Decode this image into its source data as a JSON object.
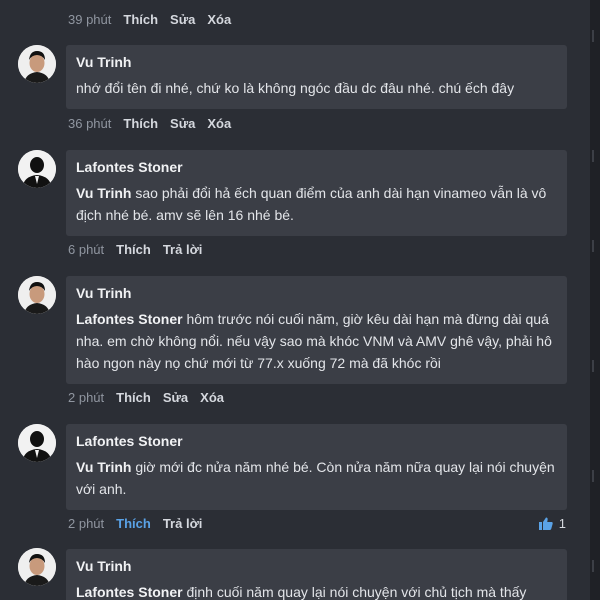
{
  "top_actions": {
    "time": "39 phút",
    "like": "Thích",
    "edit": "Sửa",
    "delete": "Xóa"
  },
  "comments": [
    {
      "author": "Vu Trinh",
      "mention": "",
      "text": "nhớ đổi tên đi nhé, chứ ko là không ngóc đầu dc đâu nhé. chú ếch đây",
      "actions": {
        "time": "36 phút",
        "like": "Thích",
        "a2": "Sửa",
        "a3": "Xóa"
      }
    },
    {
      "author": "Lafontes Stoner",
      "mention": "Vu Trinh",
      "text": " sao phải đổi hả ếch quan điểm của anh dài hạn vinameo vẫn là vô địch nhé bé. amv sẽ lên 16 nhé bé.",
      "actions": {
        "time": "6 phút",
        "like": "Thích",
        "a2": "Trả lời"
      }
    },
    {
      "author": "Vu Trinh",
      "mention": "Lafontes Stoner",
      "text": " hôm trước nói cuối năm, giờ kêu dài hạn mà đừng dài quá nha. em chờ không nổi. nếu vậy sao mà khóc VNM và AMV ghê vậy, phải hô hào ngon này nọ chứ mới từ 77.x xuống 72 mà đã khóc rồi",
      "actions": {
        "time": "2 phút",
        "like": "Thích",
        "a2": "Sửa",
        "a3": "Xóa"
      }
    },
    {
      "author": "Lafontes Stoner",
      "mention": "Vu Trinh",
      "text": " giờ mới đc nửa năm nhé bé. Còn nửa năm nữa quay lại nói chuyện với anh.",
      "actions": {
        "time": "2 phút",
        "like": "Thích",
        "a2": "Trả lời"
      },
      "likes": "1"
    },
    {
      "author": "Vu Trinh",
      "mention": "Lafontes Stoner",
      "text": " định cuối năm quay lại nói chuyện với chủ tịch mà thấy"
    }
  ],
  "colors": {
    "background": "#2b2e35",
    "bubble": "#3b3e46",
    "liked": "#5aa2e6"
  }
}
